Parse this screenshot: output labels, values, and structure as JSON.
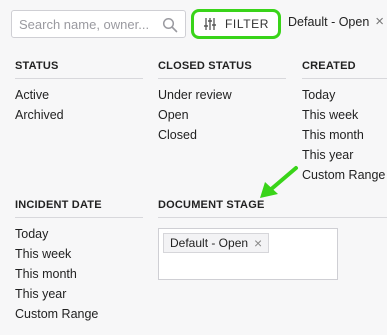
{
  "search": {
    "placeholder": "Search name, owner..."
  },
  "filter_button": {
    "label": "FILTER"
  },
  "active_filter": {
    "label": "Default - Open",
    "remove_symbol": "×"
  },
  "columns": {
    "status": {
      "heading": "STATUS",
      "options": [
        "Active",
        "Archived"
      ]
    },
    "closed_status": {
      "heading": "CLOSED STATUS",
      "options": [
        "Under review",
        "Open",
        "Closed"
      ]
    },
    "created": {
      "heading": "CREATED",
      "options": [
        "Today",
        "This week",
        "This month",
        "This year",
        "Custom Range"
      ]
    },
    "incident_date": {
      "heading": "INCIDENT DATE",
      "options": [
        "Today",
        "This week",
        "This month",
        "This year",
        "Custom Range"
      ]
    },
    "document_stage": {
      "heading": "DOCUMENT STAGE",
      "selected": [
        {
          "label": "Default - Open",
          "remove_symbol": "×"
        }
      ]
    }
  },
  "colors": {
    "highlight": "#39d419",
    "background": "#f7f7f8"
  }
}
